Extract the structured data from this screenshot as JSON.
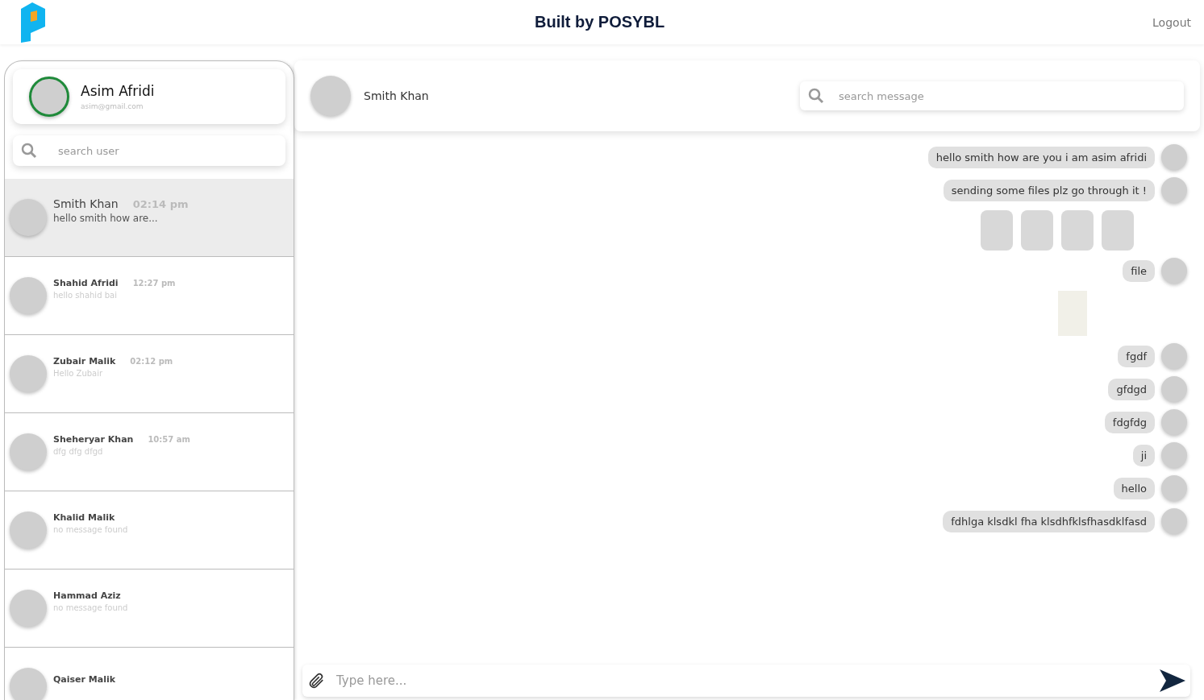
{
  "header": {
    "title": "Built by POSYBL",
    "logout": "Logout"
  },
  "profile": {
    "name": "Asim Afridi",
    "email": "asim@gmail.com"
  },
  "user_search": {
    "placeholder": "search user"
  },
  "contacts": [
    {
      "name": "Smith Khan",
      "time": "02:14 pm",
      "preview": "hello smith how are...",
      "selected": true
    },
    {
      "name": "Shahid Afridi",
      "time": "12:27 pm",
      "preview": "hello shahid bai",
      "selected": false
    },
    {
      "name": "Zubair Malik",
      "time": "02:12 pm",
      "preview": "Hello Zubair",
      "selected": false
    },
    {
      "name": "Sheheryar Khan",
      "time": "10:57 am",
      "preview": "dfg dfg dfgd",
      "selected": false
    },
    {
      "name": "Khalid Malik",
      "preview": "no message found",
      "selected": false
    },
    {
      "name": "Hammad Aziz",
      "preview": "no message found",
      "selected": false
    },
    {
      "name": "Qaiser Malik",
      "selected": false
    }
  ],
  "chat": {
    "name": "Smith Khan",
    "search": {
      "placeholder": "search message"
    },
    "messages": [
      {
        "kind": "text",
        "text": "hello smith how are you i am asim afridi"
      },
      {
        "kind": "text",
        "text": "sending some files plz go through it !"
      },
      {
        "kind": "images",
        "items": [
          {
            "kind": "photo"
          },
          {
            "kind": "photo"
          },
          {
            "kind": "photo"
          },
          {
            "kind": "photo"
          }
        ]
      },
      {
        "kind": "text",
        "text": "file"
      },
      {
        "kind": "file"
      },
      {
        "kind": "text",
        "text": "fgdf"
      },
      {
        "kind": "text",
        "text": "gfdgd"
      },
      {
        "kind": "text",
        "text": "fdgfdg"
      },
      {
        "kind": "text",
        "text": "ji"
      },
      {
        "kind": "text",
        "text": "hello"
      },
      {
        "kind": "text",
        "text": "fdhlga klsdkl fha klsdhfklsfhasdklfasd"
      }
    ],
    "composer": {
      "placeholder": "Type here..."
    }
  }
}
